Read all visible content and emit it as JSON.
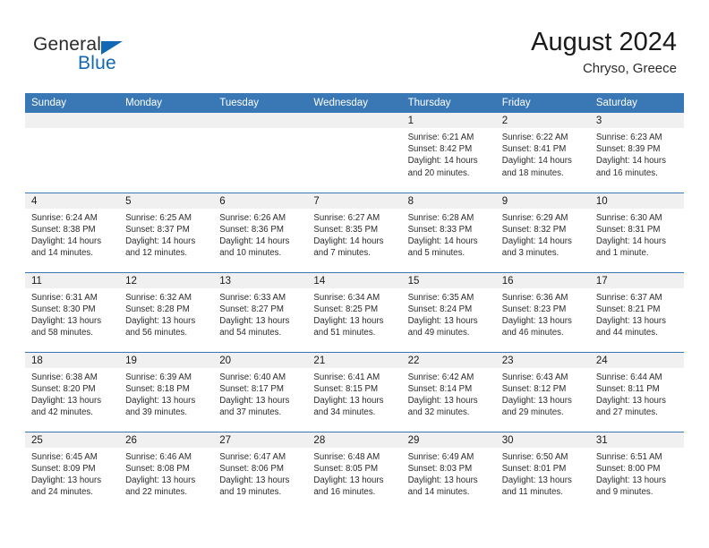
{
  "brand": {
    "name_part1": "General",
    "name_part2": "Blue",
    "accent_color": "#1268b3",
    "triangle_icon": "triangle-logo-icon"
  },
  "header": {
    "title": "August 2024",
    "location": "Chryso, Greece"
  },
  "theme": {
    "header_bg": "#3a78b5",
    "daynum_bg": "#f0f0f0",
    "row_divider": "#3a78b5",
    "text": "#2b2b2b"
  },
  "weekday_headers": [
    "Sunday",
    "Monday",
    "Tuesday",
    "Wednesday",
    "Thursday",
    "Friday",
    "Saturday"
  ],
  "labels": {
    "sunrise_prefix": "Sunrise:",
    "sunset_prefix": "Sunset:",
    "daylight_prefix": "Daylight:"
  },
  "weeks": [
    [
      {
        "day": "",
        "sunrise": "",
        "sunset": "",
        "daylight_line1": "",
        "daylight_line2": ""
      },
      {
        "day": "",
        "sunrise": "",
        "sunset": "",
        "daylight_line1": "",
        "daylight_line2": ""
      },
      {
        "day": "",
        "sunrise": "",
        "sunset": "",
        "daylight_line1": "",
        "daylight_line2": ""
      },
      {
        "day": "",
        "sunrise": "",
        "sunset": "",
        "daylight_line1": "",
        "daylight_line2": ""
      },
      {
        "day": "1",
        "sunrise": "Sunrise: 6:21 AM",
        "sunset": "Sunset: 8:42 PM",
        "daylight_line1": "Daylight: 14 hours",
        "daylight_line2": "and 20 minutes."
      },
      {
        "day": "2",
        "sunrise": "Sunrise: 6:22 AM",
        "sunset": "Sunset: 8:41 PM",
        "daylight_line1": "Daylight: 14 hours",
        "daylight_line2": "and 18 minutes."
      },
      {
        "day": "3",
        "sunrise": "Sunrise: 6:23 AM",
        "sunset": "Sunset: 8:39 PM",
        "daylight_line1": "Daylight: 14 hours",
        "daylight_line2": "and 16 minutes."
      }
    ],
    [
      {
        "day": "4",
        "sunrise": "Sunrise: 6:24 AM",
        "sunset": "Sunset: 8:38 PM",
        "daylight_line1": "Daylight: 14 hours",
        "daylight_line2": "and 14 minutes."
      },
      {
        "day": "5",
        "sunrise": "Sunrise: 6:25 AM",
        "sunset": "Sunset: 8:37 PM",
        "daylight_line1": "Daylight: 14 hours",
        "daylight_line2": "and 12 minutes."
      },
      {
        "day": "6",
        "sunrise": "Sunrise: 6:26 AM",
        "sunset": "Sunset: 8:36 PM",
        "daylight_line1": "Daylight: 14 hours",
        "daylight_line2": "and 10 minutes."
      },
      {
        "day": "7",
        "sunrise": "Sunrise: 6:27 AM",
        "sunset": "Sunset: 8:35 PM",
        "daylight_line1": "Daylight: 14 hours",
        "daylight_line2": "and 7 minutes."
      },
      {
        "day": "8",
        "sunrise": "Sunrise: 6:28 AM",
        "sunset": "Sunset: 8:33 PM",
        "daylight_line1": "Daylight: 14 hours",
        "daylight_line2": "and 5 minutes."
      },
      {
        "day": "9",
        "sunrise": "Sunrise: 6:29 AM",
        "sunset": "Sunset: 8:32 PM",
        "daylight_line1": "Daylight: 14 hours",
        "daylight_line2": "and 3 minutes."
      },
      {
        "day": "10",
        "sunrise": "Sunrise: 6:30 AM",
        "sunset": "Sunset: 8:31 PM",
        "daylight_line1": "Daylight: 14 hours",
        "daylight_line2": "and 1 minute."
      }
    ],
    [
      {
        "day": "11",
        "sunrise": "Sunrise: 6:31 AM",
        "sunset": "Sunset: 8:30 PM",
        "daylight_line1": "Daylight: 13 hours",
        "daylight_line2": "and 58 minutes."
      },
      {
        "day": "12",
        "sunrise": "Sunrise: 6:32 AM",
        "sunset": "Sunset: 8:28 PM",
        "daylight_line1": "Daylight: 13 hours",
        "daylight_line2": "and 56 minutes."
      },
      {
        "day": "13",
        "sunrise": "Sunrise: 6:33 AM",
        "sunset": "Sunset: 8:27 PM",
        "daylight_line1": "Daylight: 13 hours",
        "daylight_line2": "and 54 minutes."
      },
      {
        "day": "14",
        "sunrise": "Sunrise: 6:34 AM",
        "sunset": "Sunset: 8:25 PM",
        "daylight_line1": "Daylight: 13 hours",
        "daylight_line2": "and 51 minutes."
      },
      {
        "day": "15",
        "sunrise": "Sunrise: 6:35 AM",
        "sunset": "Sunset: 8:24 PM",
        "daylight_line1": "Daylight: 13 hours",
        "daylight_line2": "and 49 minutes."
      },
      {
        "day": "16",
        "sunrise": "Sunrise: 6:36 AM",
        "sunset": "Sunset: 8:23 PM",
        "daylight_line1": "Daylight: 13 hours",
        "daylight_line2": "and 46 minutes."
      },
      {
        "day": "17",
        "sunrise": "Sunrise: 6:37 AM",
        "sunset": "Sunset: 8:21 PM",
        "daylight_line1": "Daylight: 13 hours",
        "daylight_line2": "and 44 minutes."
      }
    ],
    [
      {
        "day": "18",
        "sunrise": "Sunrise: 6:38 AM",
        "sunset": "Sunset: 8:20 PM",
        "daylight_line1": "Daylight: 13 hours",
        "daylight_line2": "and 42 minutes."
      },
      {
        "day": "19",
        "sunrise": "Sunrise: 6:39 AM",
        "sunset": "Sunset: 8:18 PM",
        "daylight_line1": "Daylight: 13 hours",
        "daylight_line2": "and 39 minutes."
      },
      {
        "day": "20",
        "sunrise": "Sunrise: 6:40 AM",
        "sunset": "Sunset: 8:17 PM",
        "daylight_line1": "Daylight: 13 hours",
        "daylight_line2": "and 37 minutes."
      },
      {
        "day": "21",
        "sunrise": "Sunrise: 6:41 AM",
        "sunset": "Sunset: 8:15 PM",
        "daylight_line1": "Daylight: 13 hours",
        "daylight_line2": "and 34 minutes."
      },
      {
        "day": "22",
        "sunrise": "Sunrise: 6:42 AM",
        "sunset": "Sunset: 8:14 PM",
        "daylight_line1": "Daylight: 13 hours",
        "daylight_line2": "and 32 minutes."
      },
      {
        "day": "23",
        "sunrise": "Sunrise: 6:43 AM",
        "sunset": "Sunset: 8:12 PM",
        "daylight_line1": "Daylight: 13 hours",
        "daylight_line2": "and 29 minutes."
      },
      {
        "day": "24",
        "sunrise": "Sunrise: 6:44 AM",
        "sunset": "Sunset: 8:11 PM",
        "daylight_line1": "Daylight: 13 hours",
        "daylight_line2": "and 27 minutes."
      }
    ],
    [
      {
        "day": "25",
        "sunrise": "Sunrise: 6:45 AM",
        "sunset": "Sunset: 8:09 PM",
        "daylight_line1": "Daylight: 13 hours",
        "daylight_line2": "and 24 minutes."
      },
      {
        "day": "26",
        "sunrise": "Sunrise: 6:46 AM",
        "sunset": "Sunset: 8:08 PM",
        "daylight_line1": "Daylight: 13 hours",
        "daylight_line2": "and 22 minutes."
      },
      {
        "day": "27",
        "sunrise": "Sunrise: 6:47 AM",
        "sunset": "Sunset: 8:06 PM",
        "daylight_line1": "Daylight: 13 hours",
        "daylight_line2": "and 19 minutes."
      },
      {
        "day": "28",
        "sunrise": "Sunrise: 6:48 AM",
        "sunset": "Sunset: 8:05 PM",
        "daylight_line1": "Daylight: 13 hours",
        "daylight_line2": "and 16 minutes."
      },
      {
        "day": "29",
        "sunrise": "Sunrise: 6:49 AM",
        "sunset": "Sunset: 8:03 PM",
        "daylight_line1": "Daylight: 13 hours",
        "daylight_line2": "and 14 minutes."
      },
      {
        "day": "30",
        "sunrise": "Sunrise: 6:50 AM",
        "sunset": "Sunset: 8:01 PM",
        "daylight_line1": "Daylight: 13 hours",
        "daylight_line2": "and 11 minutes."
      },
      {
        "day": "31",
        "sunrise": "Sunrise: 6:51 AM",
        "sunset": "Sunset: 8:00 PM",
        "daylight_line1": "Daylight: 13 hours",
        "daylight_line2": "and 9 minutes."
      }
    ]
  ]
}
